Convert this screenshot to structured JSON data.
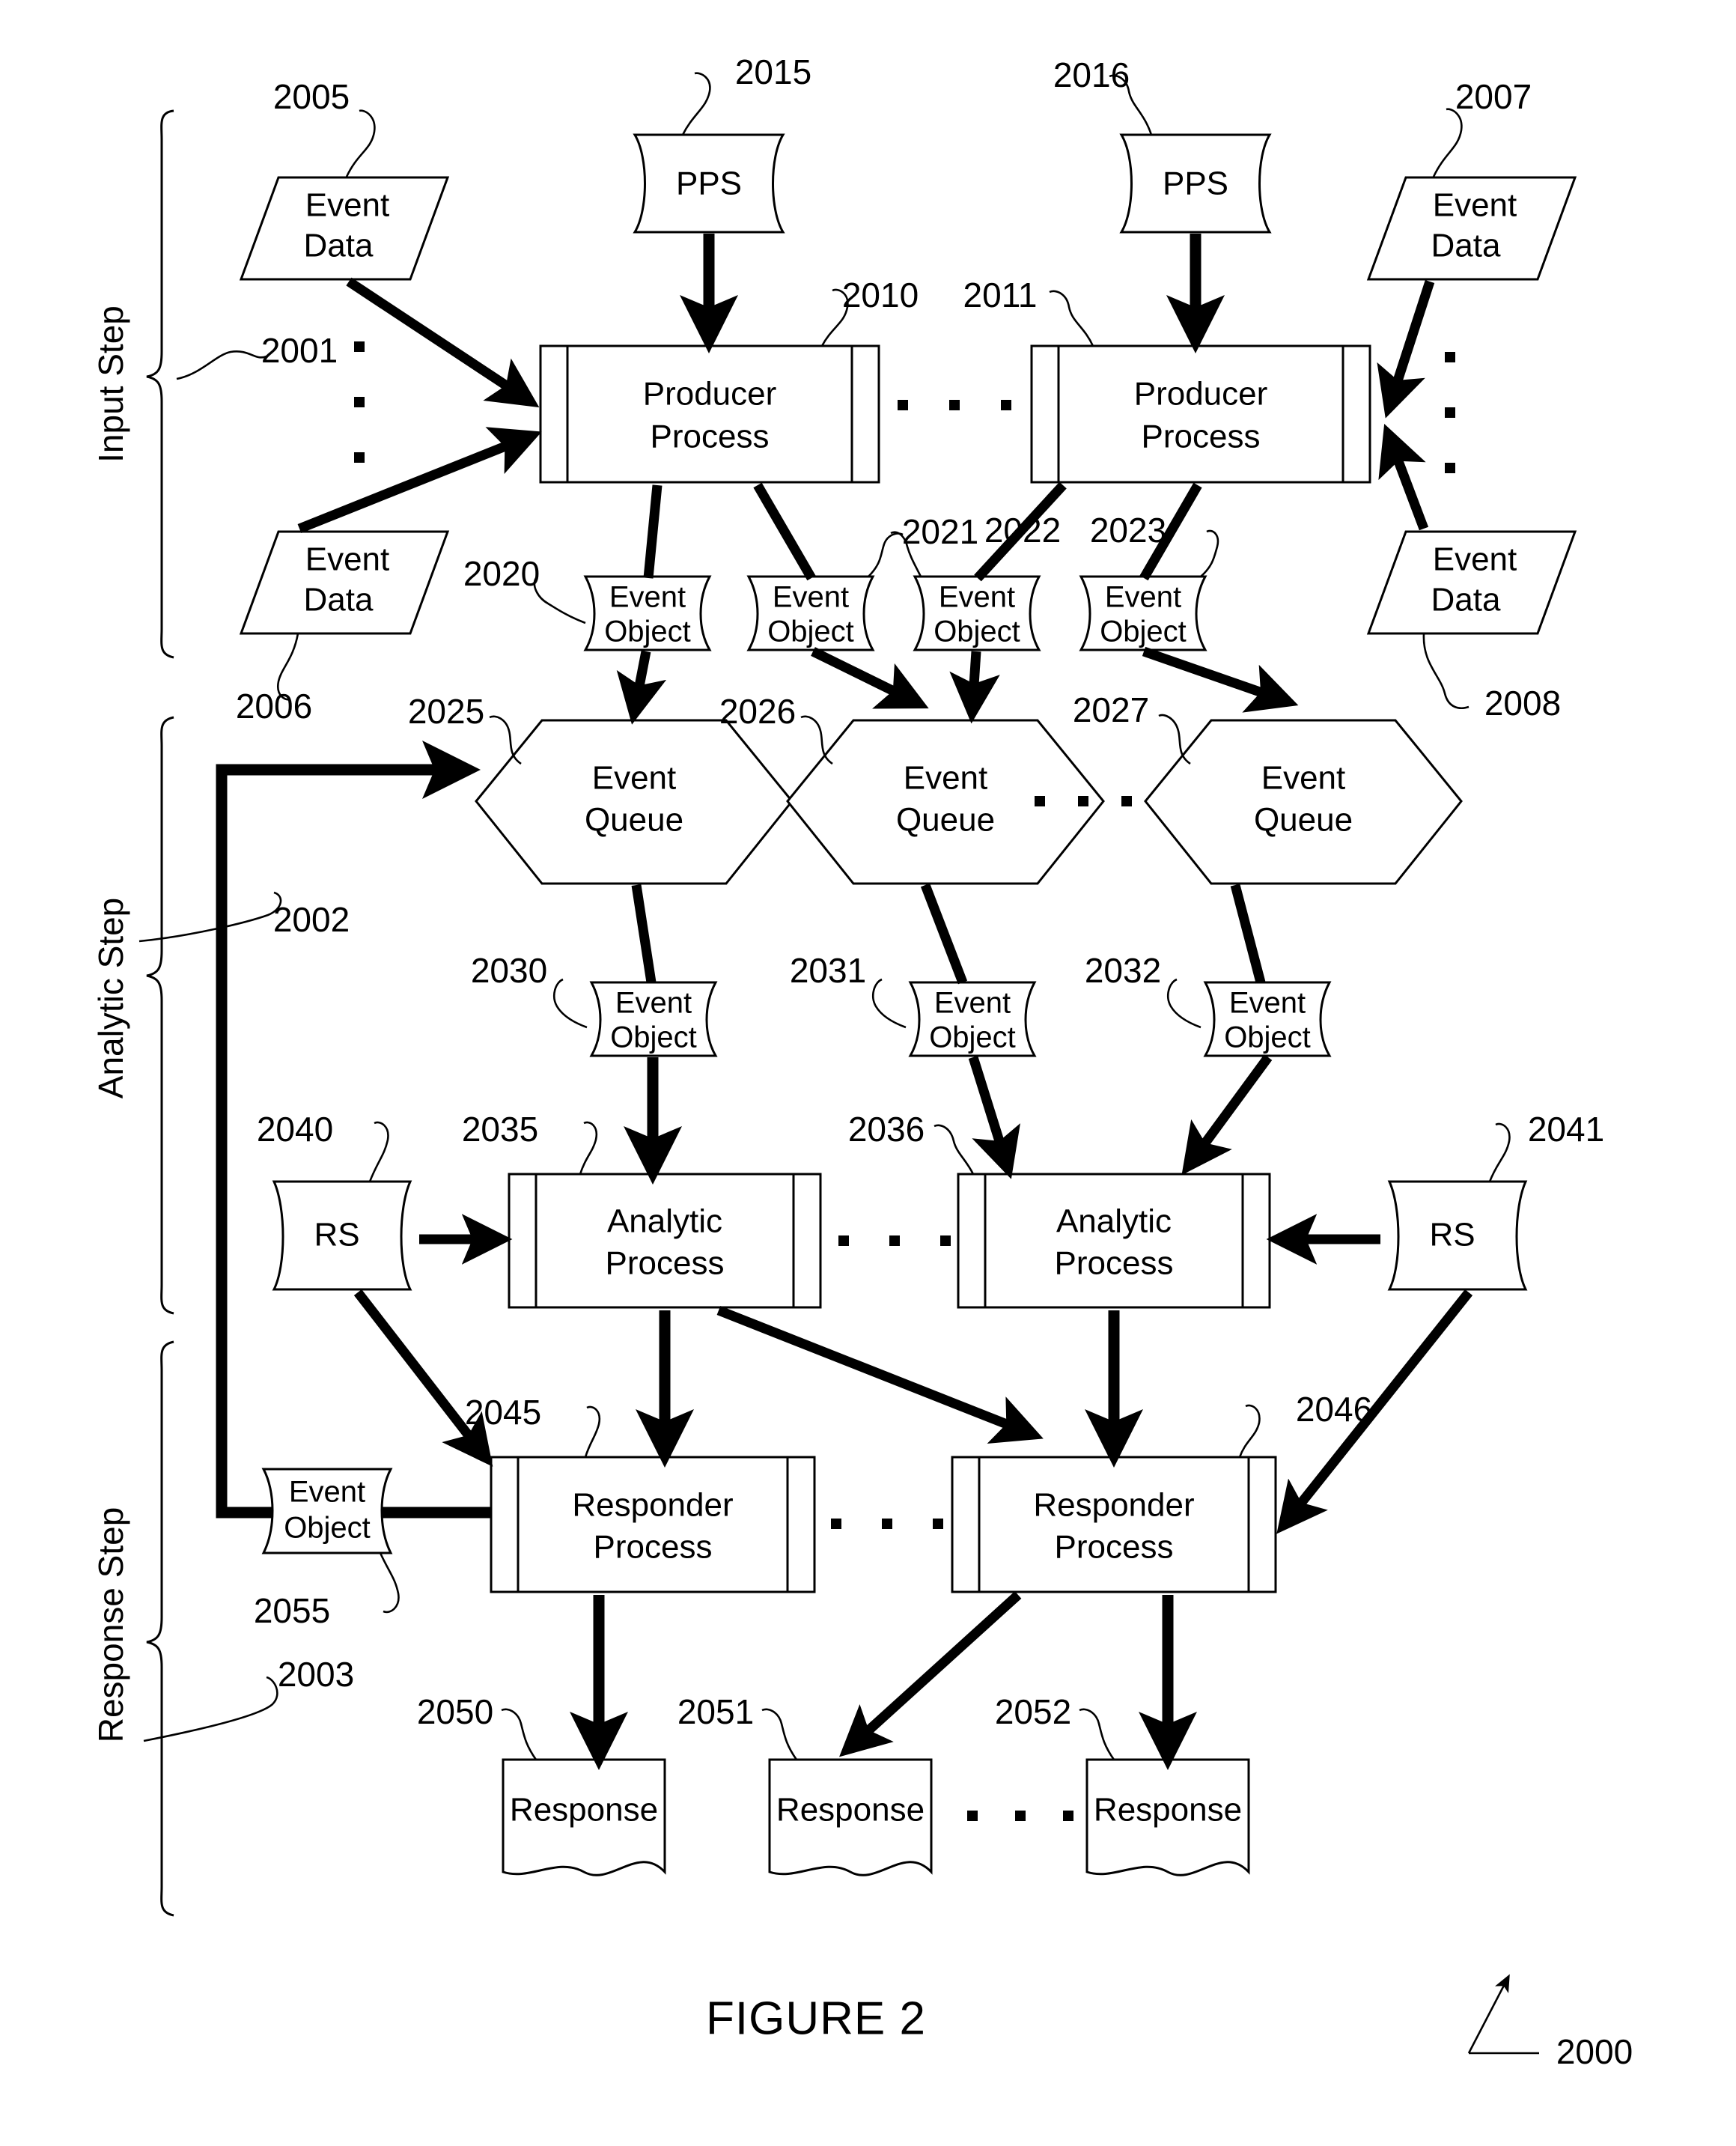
{
  "figure": {
    "title": "FIGURE 2",
    "system_ref": "2000"
  },
  "steps": [
    {
      "label": "Input Step",
      "ref": "2001"
    },
    {
      "label": "Analytic Step",
      "ref": "2002"
    },
    {
      "label": "Response Step",
      "ref": "2003"
    }
  ],
  "nodes": {
    "event_data": [
      {
        "line1": "Event",
        "line2": "Data",
        "ref": "2005"
      },
      {
        "line1": "Event",
        "line2": "Data",
        "ref": "2006"
      },
      {
        "line1": "Event",
        "line2": "Data",
        "ref": "2007"
      },
      {
        "line1": "Event",
        "line2": "Data",
        "ref": "2008"
      }
    ],
    "pps": [
      {
        "label": "PPS",
        "ref": "2015"
      },
      {
        "label": "PPS",
        "ref": "2016"
      }
    ],
    "producer_process": [
      {
        "line1": "Producer",
        "line2": "Process",
        "ref": "2010"
      },
      {
        "line1": "Producer",
        "line2": "Process",
        "ref": "2011"
      }
    ],
    "event_object_top": [
      {
        "line1": "Event",
        "line2": "Object",
        "ref": "2020"
      },
      {
        "line1": "Event",
        "line2": "Object",
        "ref": "2021"
      },
      {
        "line1": "Event",
        "line2": "Object",
        "ref": "2022"
      },
      {
        "line1": "Event",
        "line2": "Object",
        "ref": "2023"
      }
    ],
    "event_queue": [
      {
        "line1": "Event",
        "line2": "Queue",
        "ref": "2025"
      },
      {
        "line1": "Event",
        "line2": "Queue",
        "ref": "2026"
      },
      {
        "line1": "Event",
        "line2": "Queue",
        "ref": "2027"
      }
    ],
    "event_object_mid": [
      {
        "line1": "Event",
        "line2": "Object",
        "ref": "2030"
      },
      {
        "line1": "Event",
        "line2": "Object",
        "ref": "2031"
      },
      {
        "line1": "Event",
        "line2": "Object",
        "ref": "2032"
      }
    ],
    "analytic_process": [
      {
        "line1": "Analytic",
        "line2": "Process",
        "ref": "2035"
      },
      {
        "line1": "Analytic",
        "line2": "Process",
        "ref": "2036"
      }
    ],
    "rs": [
      {
        "label": "RS",
        "ref": "2040"
      },
      {
        "label": "RS",
        "ref": "2041"
      }
    ],
    "responder_process": [
      {
        "line1": "Responder",
        "line2": "Process",
        "ref": "2045"
      },
      {
        "line1": "Responder",
        "line2": "Process",
        "ref": "2046"
      }
    ],
    "event_object_feedback": {
      "line1": "Event",
      "line2": "Object",
      "ref": "2055"
    },
    "response": [
      {
        "label": "Response",
        "ref": "2050"
      },
      {
        "label": "Response",
        "ref": "2051"
      },
      {
        "label": "Response",
        "ref": "2052"
      }
    ]
  },
  "colors": {
    "stroke": "#000000",
    "fill": "#ffffff"
  }
}
